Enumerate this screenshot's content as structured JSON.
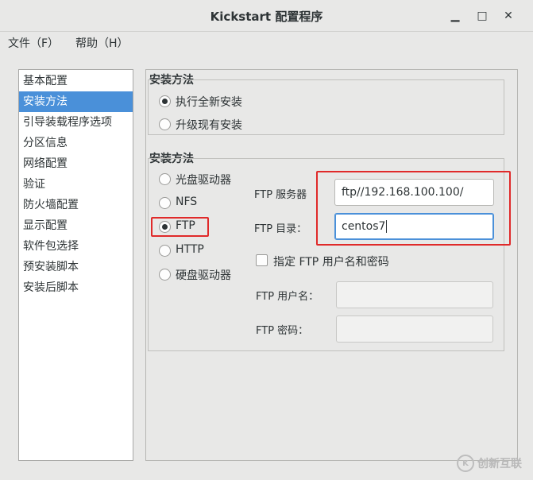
{
  "window": {
    "title": "Kickstart 配置程序",
    "minimize_glyph": "▁",
    "maximize_glyph": "□",
    "close_glyph": "✕"
  },
  "menubar": {
    "file": "文件（F）",
    "help": "帮助（H）"
  },
  "nav": {
    "items": [
      {
        "label": "基本配置"
      },
      {
        "label": "安装方法"
      },
      {
        "label": "引导装载程序选项"
      },
      {
        "label": "分区信息"
      },
      {
        "label": "网络配置"
      },
      {
        "label": "验证"
      },
      {
        "label": "防火墙配置"
      },
      {
        "label": "显示配置"
      },
      {
        "label": "软件包选择"
      },
      {
        "label": "预安装脚本"
      },
      {
        "label": "安装后脚本"
      }
    ],
    "selected": "安装方法"
  },
  "install_type": {
    "title": "安装方法",
    "options": [
      {
        "label": "执行全新安装",
        "checked": true
      },
      {
        "label": "升级现有安装",
        "checked": false
      }
    ]
  },
  "install_source": {
    "title": "安装方法",
    "options": [
      {
        "label": "光盘驱动器",
        "checked": false
      },
      {
        "label": "NFS",
        "checked": false
      },
      {
        "label": "FTP",
        "checked": true
      },
      {
        "label": "HTTP",
        "checked": false
      },
      {
        "label": "硬盘驱动器",
        "checked": false
      }
    ]
  },
  "ftp": {
    "server_label": "FTP 服务器",
    "server_value": "ftp//192.168.100.100/",
    "dir_label": "FTP 目录：",
    "dir_value": "centos7",
    "specify_label": "指定  FTP 用户名和密码",
    "specify_checked": false,
    "user_label": "FTP 用户名：",
    "user_value": "",
    "password_label": "FTP 密码：",
    "password_value": ""
  },
  "highlight_color": "#e02a2a",
  "accent_color": "#4a90d9",
  "watermark": {
    "logo_text": "K",
    "text": "创新互联"
  }
}
